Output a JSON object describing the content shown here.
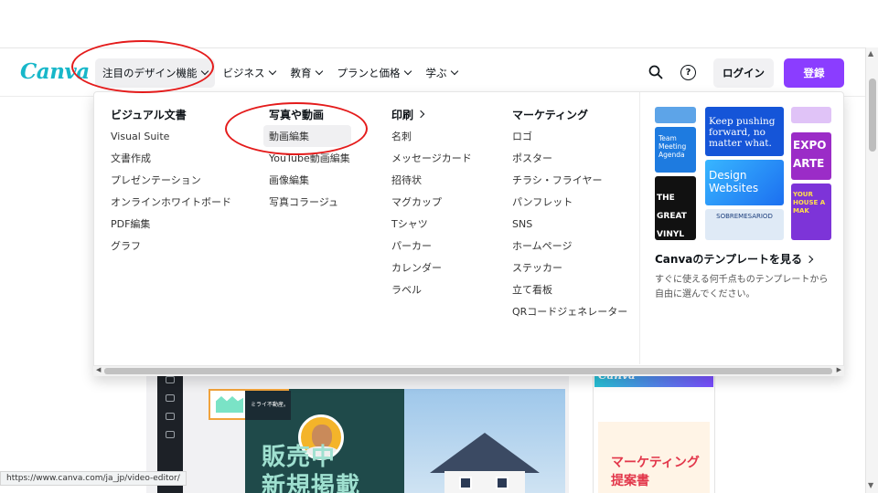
{
  "header": {
    "logo": "Canva",
    "nav": [
      {
        "label": "注目のデザイン機能",
        "active": true
      },
      {
        "label": "ビジネス",
        "active": false
      },
      {
        "label": "教育",
        "active": false
      },
      {
        "label": "プランと価格",
        "active": false
      },
      {
        "label": "学ぶ",
        "active": false
      }
    ],
    "help": "?",
    "login": "ログイン",
    "signup": "登録"
  },
  "dropdown": {
    "columns": [
      {
        "title": "ビジュアル文書",
        "links": [
          "Visual Suite",
          "文書作成",
          "プレゼンテーション",
          "オンラインホワイトボード",
          "PDF編集",
          "グラフ"
        ]
      },
      {
        "title": "写真や動画",
        "links": [
          "動画編集",
          "YouTube動画編集",
          "画像編集",
          "写真コラージュ"
        ]
      },
      {
        "title": "印刷",
        "links": [
          "名刺",
          "メッセージカード",
          "招待状",
          "マグカップ",
          "Tシャツ",
          "パーカー",
          "カレンダー",
          "ラベル"
        ]
      },
      {
        "title": "マーケティング",
        "links": [
          "ロゴ",
          "ポスター",
          "チラシ・フライヤー",
          "パンフレット",
          "SNS",
          "ホームページ",
          "ステッカー",
          "立て看板",
          "QRコードジェネレーター"
        ]
      }
    ],
    "templates": {
      "thumbs": {
        "team": "Team Meeting Agenda",
        "great": "THE GREAT VINYL SALE",
        "keep": "Keep pushing forward, no matter what.",
        "design": "Design Websites",
        "sobre": "SOBREMESARIOD",
        "expo": "EXPO ARTE",
        "house": "YOUR HOUSE A MAK"
      },
      "link": "Canvaのテンプレートを見る",
      "description": "すぐに使える何千点ものテンプレートから自由に選んでください。"
    }
  },
  "background": {
    "tag": "ミライ不動産。",
    "headline1": "販売中",
    "headline2": "新規掲載",
    "card_logo": "Canva",
    "card_line1": "マーケティング",
    "card_line2": "提案書"
  },
  "status_url": "https://www.canva.com/ja_jp/video-editor/",
  "colors": {
    "brand": "#8b3dff",
    "logo": "#18b7c9",
    "annotation": "#e41b1b"
  }
}
